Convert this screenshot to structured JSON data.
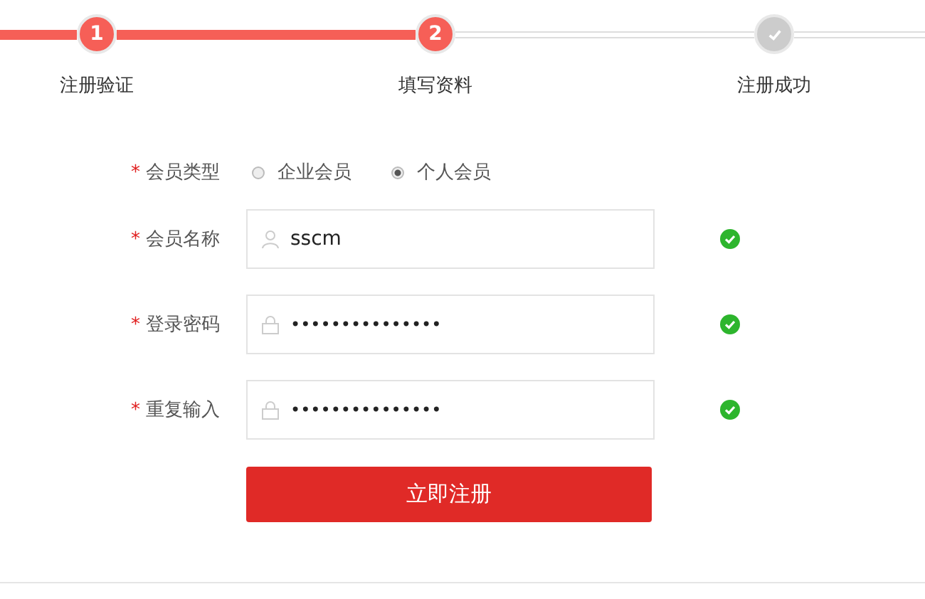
{
  "steps": [
    {
      "number": "1",
      "label": "注册验证",
      "completed": true,
      "active": false
    },
    {
      "number": "2",
      "label": "填写资料",
      "completed": false,
      "active": true
    },
    {
      "label": "注册成功",
      "completed": false,
      "active": false
    }
  ],
  "form": {
    "member_type": {
      "label": "会员类型",
      "required_mark": "*",
      "options": [
        {
          "label": "企业会员",
          "selected": false
        },
        {
          "label": "个人会员",
          "selected": true
        }
      ]
    },
    "fields": [
      {
        "label": "会员名称",
        "required_mark": "*",
        "kind": "text",
        "value": "sscm",
        "valid": true
      },
      {
        "label": "登录密码",
        "required_mark": "*",
        "kind": "password",
        "value": "•••••••••••••••",
        "valid": true
      },
      {
        "label": "重复输入",
        "required_mark": "*",
        "kind": "password",
        "value": "•••••••••••••••",
        "valid": true
      }
    ],
    "submit": "立即注册"
  }
}
